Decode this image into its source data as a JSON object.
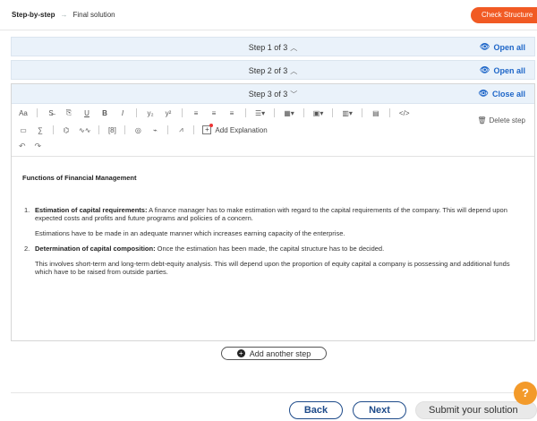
{
  "breadcrumb": {
    "first": "Step-by-step",
    "second": "Final solution"
  },
  "header": {
    "check_button": "Check Structure"
  },
  "steps": [
    {
      "label": "Step 1 of 3",
      "action": "Open all"
    },
    {
      "label": "Step 2 of 3",
      "action": "Open all"
    },
    {
      "label": "Step 3 of 3",
      "action": "Close all"
    }
  ],
  "toolbar": {
    "font_size": "Aa",
    "bold": "B",
    "italic": "I",
    "underline": "U",
    "subscript": "y₂",
    "superscript": "y²",
    "code": "</>",
    "delete_step": "Delete step",
    "add_explanation": "Add Explanation"
  },
  "content": {
    "heading": "Functions of Financial Management",
    "items": [
      {
        "num": "1.",
        "title": "Estimation of capital requirements:",
        "text": " A finance manager has to make estimation with regard to the capital requirements of the company. This will depend upon expected costs and profits and future programs and policies of a concern.",
        "para": "Estimations have to be made in an adequate manner which increases earning capacity of the enterprise."
      },
      {
        "num": "2.",
        "title": "Determination of capital composition:",
        "text": " Once the estimation has been made, the capital structure has to be decided.",
        "para": "This involves short-term and long-term debt-equity analysis. This will depend upon the proportion of equity capital a company is possessing and additional funds which have to be raised from outside parties."
      }
    ]
  },
  "add_step": "Add another step",
  "footer": {
    "back": "Back",
    "next": "Next",
    "submit": "Submit your solution",
    "help": "?"
  },
  "colors": {
    "accent": "#1e66c8",
    "orange": "#f15a24",
    "panel": "#eaf2fa"
  }
}
